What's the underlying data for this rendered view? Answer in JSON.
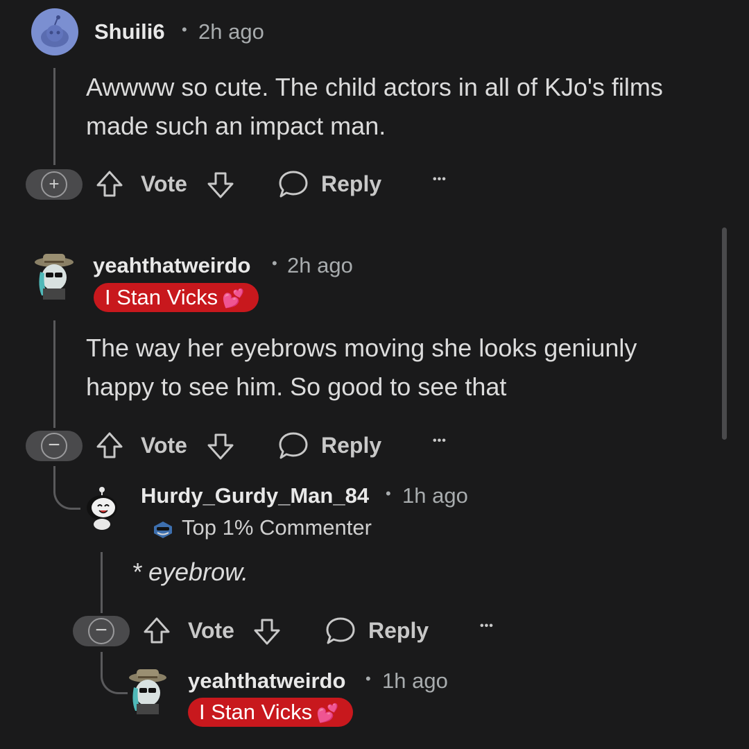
{
  "comments": [
    {
      "username": "Shuili6",
      "time": "2h ago",
      "body": "Awwww so cute. The child actors in all of KJo's films made such an impact man.",
      "collapse_symbol": "+",
      "actions": {
        "vote": "Vote",
        "reply": "Reply",
        "more": "•••"
      }
    },
    {
      "username": "yeahthatweirdo",
      "time": "2h ago",
      "flair": "I Stan Vicks",
      "flair_emoji": "💕",
      "body": "The way her eyebrows moving she looks geniunly happy to see him. So good to see that",
      "collapse_symbol": "−",
      "actions": {
        "vote": "Vote",
        "reply": "Reply",
        "more": "•••"
      }
    },
    {
      "username": "Hurdy_Gurdy_Man_84",
      "time": "1h ago",
      "badge": "Top 1% Commenter",
      "body": "* eyebrow.",
      "collapse_symbol": "−",
      "actions": {
        "vote": "Vote",
        "reply": "Reply",
        "more": "•••"
      }
    },
    {
      "username": "yeahthatweirdo",
      "time": "1h ago",
      "flair": "I Stan Vicks",
      "flair_emoji": "💕"
    }
  ],
  "separator": "•",
  "colors": {
    "background": "#1a1a1b",
    "flair": "#c8181d",
    "thread": "#5a5a5c"
  }
}
